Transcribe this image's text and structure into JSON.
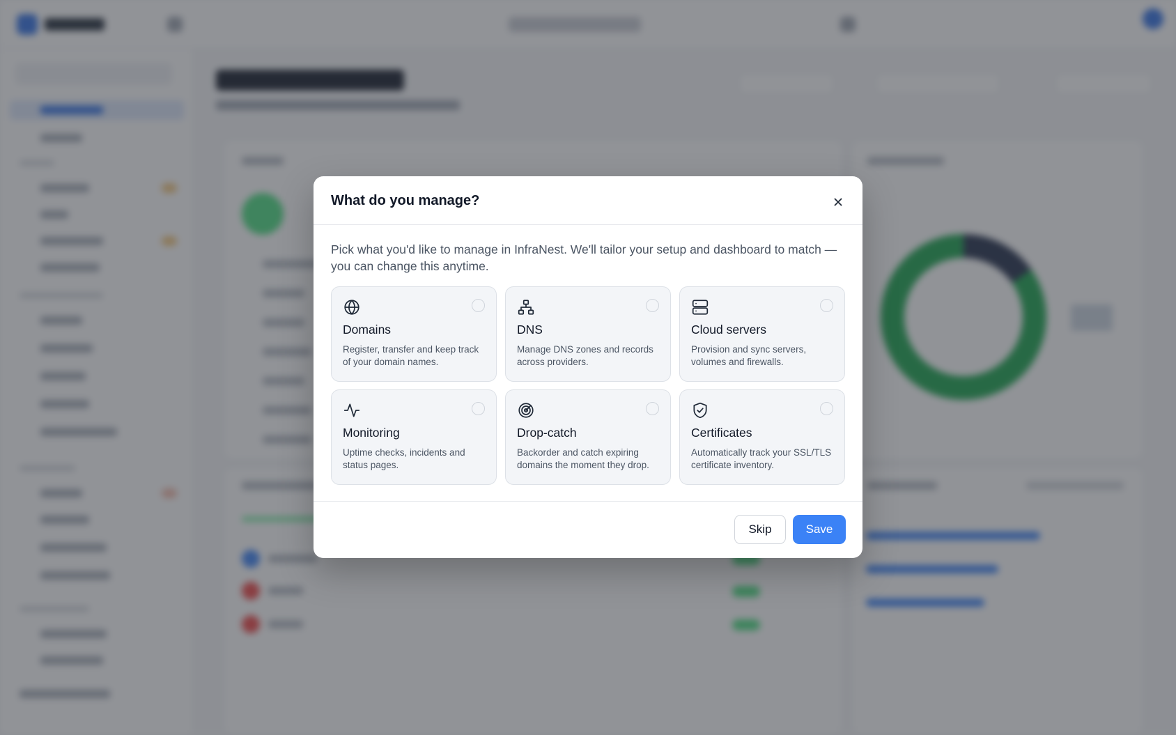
{
  "modal": {
    "title": "What do you manage?",
    "description": "Pick what you'd like to manage in InfraNest. We'll tailor your setup and dashboard to match — you can change this anytime.",
    "options": [
      {
        "title": "Domains",
        "description": "Register, transfer and keep track of your domain names.",
        "icon": "globe-icon",
        "selected": false
      },
      {
        "title": "DNS",
        "description": "Manage DNS zones and records across providers.",
        "icon": "network-icon",
        "selected": false
      },
      {
        "title": "Cloud servers",
        "description": "Provision and sync servers, volumes and firewalls.",
        "icon": "server-icon",
        "selected": false
      },
      {
        "title": "Monitoring",
        "description": "Uptime checks, incidents and status pages.",
        "icon": "activity-icon",
        "selected": false
      },
      {
        "title": "Drop-catch",
        "description": "Backorder and catch expiring domains the moment they drop.",
        "icon": "radar-icon",
        "selected": false
      },
      {
        "title": "Certificates",
        "description": "Automatically track your SSL/TLS certificate inventory.",
        "icon": "shield-check-icon",
        "selected": false
      }
    ],
    "skip_label": "Skip",
    "save_label": "Save"
  },
  "colors": {
    "accent": "#3b82f6",
    "overlay": "rgba(55,58,66,0.55)",
    "donut_green": "#16a34a",
    "donut_navy": "#1e2a47"
  }
}
